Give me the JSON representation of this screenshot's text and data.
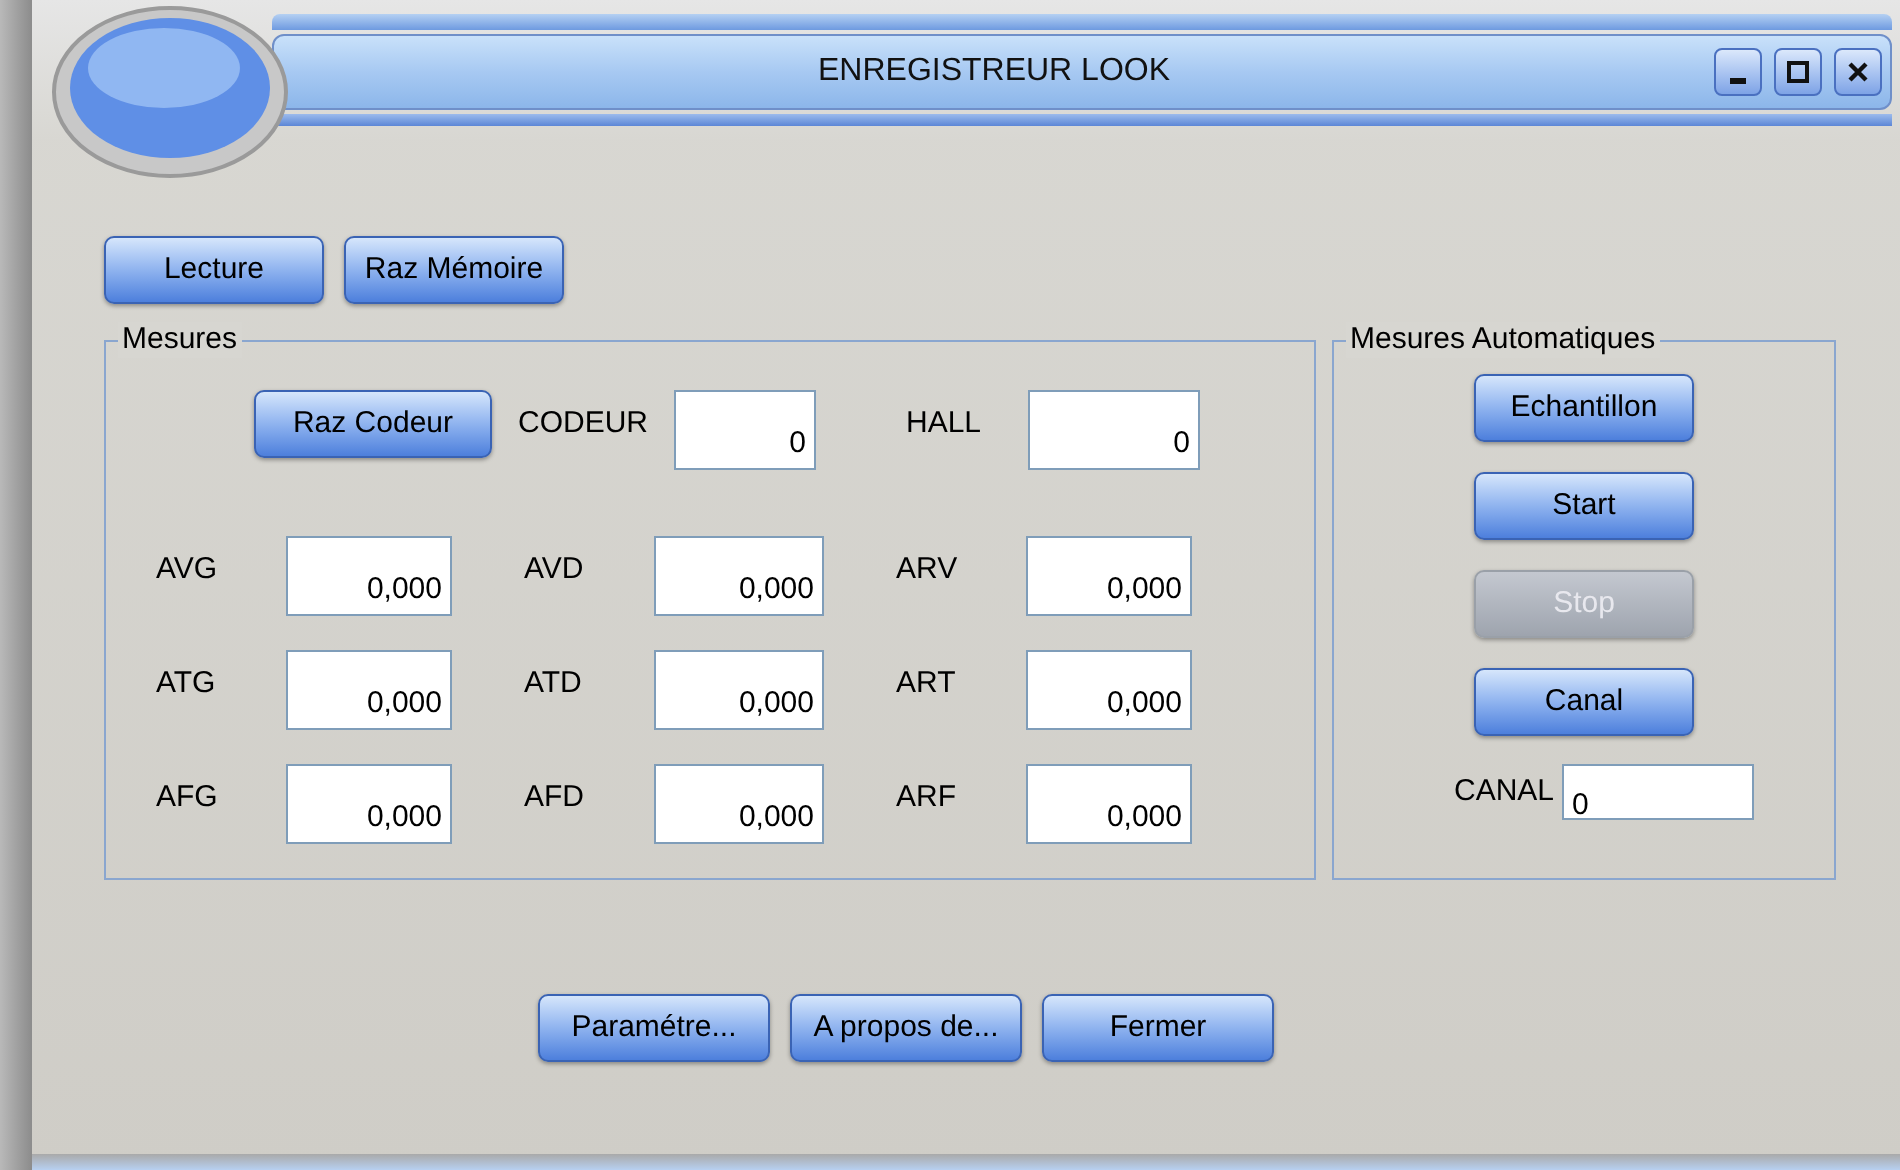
{
  "window": {
    "title": "ENREGISTREUR LOOK",
    "controls": [
      {
        "kind": "minimize"
      },
      {
        "kind": "maximize"
      },
      {
        "kind": "close"
      }
    ]
  },
  "toolbar": [
    {
      "label": "Lecture",
      "disabled": false
    },
    {
      "label": "Raz Mémoire",
      "disabled": false
    }
  ],
  "mesures": {
    "title": "Mesures",
    "reset_button": {
      "label": "Raz Codeur",
      "disabled": false
    },
    "top_fields": [
      {
        "label": "CODEUR",
        "value": "0"
      },
      {
        "label": "HALL",
        "value": "0"
      }
    ],
    "rows": [
      [
        {
          "label": "AVG",
          "value": "0,000"
        },
        {
          "label": "AVD",
          "value": "0,000"
        },
        {
          "label": "ARV",
          "value": "0,000"
        }
      ],
      [
        {
          "label": "ATG",
          "value": "0,000"
        },
        {
          "label": "ATD",
          "value": "0,000"
        },
        {
          "label": "ART",
          "value": "0,000"
        }
      ],
      [
        {
          "label": "AFG",
          "value": "0,000"
        },
        {
          "label": "AFD",
          "value": "0,000"
        },
        {
          "label": "ARF",
          "value": "0,000"
        }
      ]
    ]
  },
  "auto": {
    "title": "Mesures Automatiques",
    "buttons": [
      {
        "label": "Echantillon",
        "disabled": false
      },
      {
        "label": "Start",
        "disabled": false
      },
      {
        "label": "Stop",
        "disabled": true
      },
      {
        "label": "Canal",
        "disabled": false
      }
    ],
    "canal": {
      "label": "CANAL",
      "value": "0"
    }
  },
  "footer": [
    {
      "label": "Paramétre...",
      "disabled": false
    },
    {
      "label": "A propos de...",
      "disabled": false
    },
    {
      "label": "Fermer",
      "disabled": false
    }
  ]
}
